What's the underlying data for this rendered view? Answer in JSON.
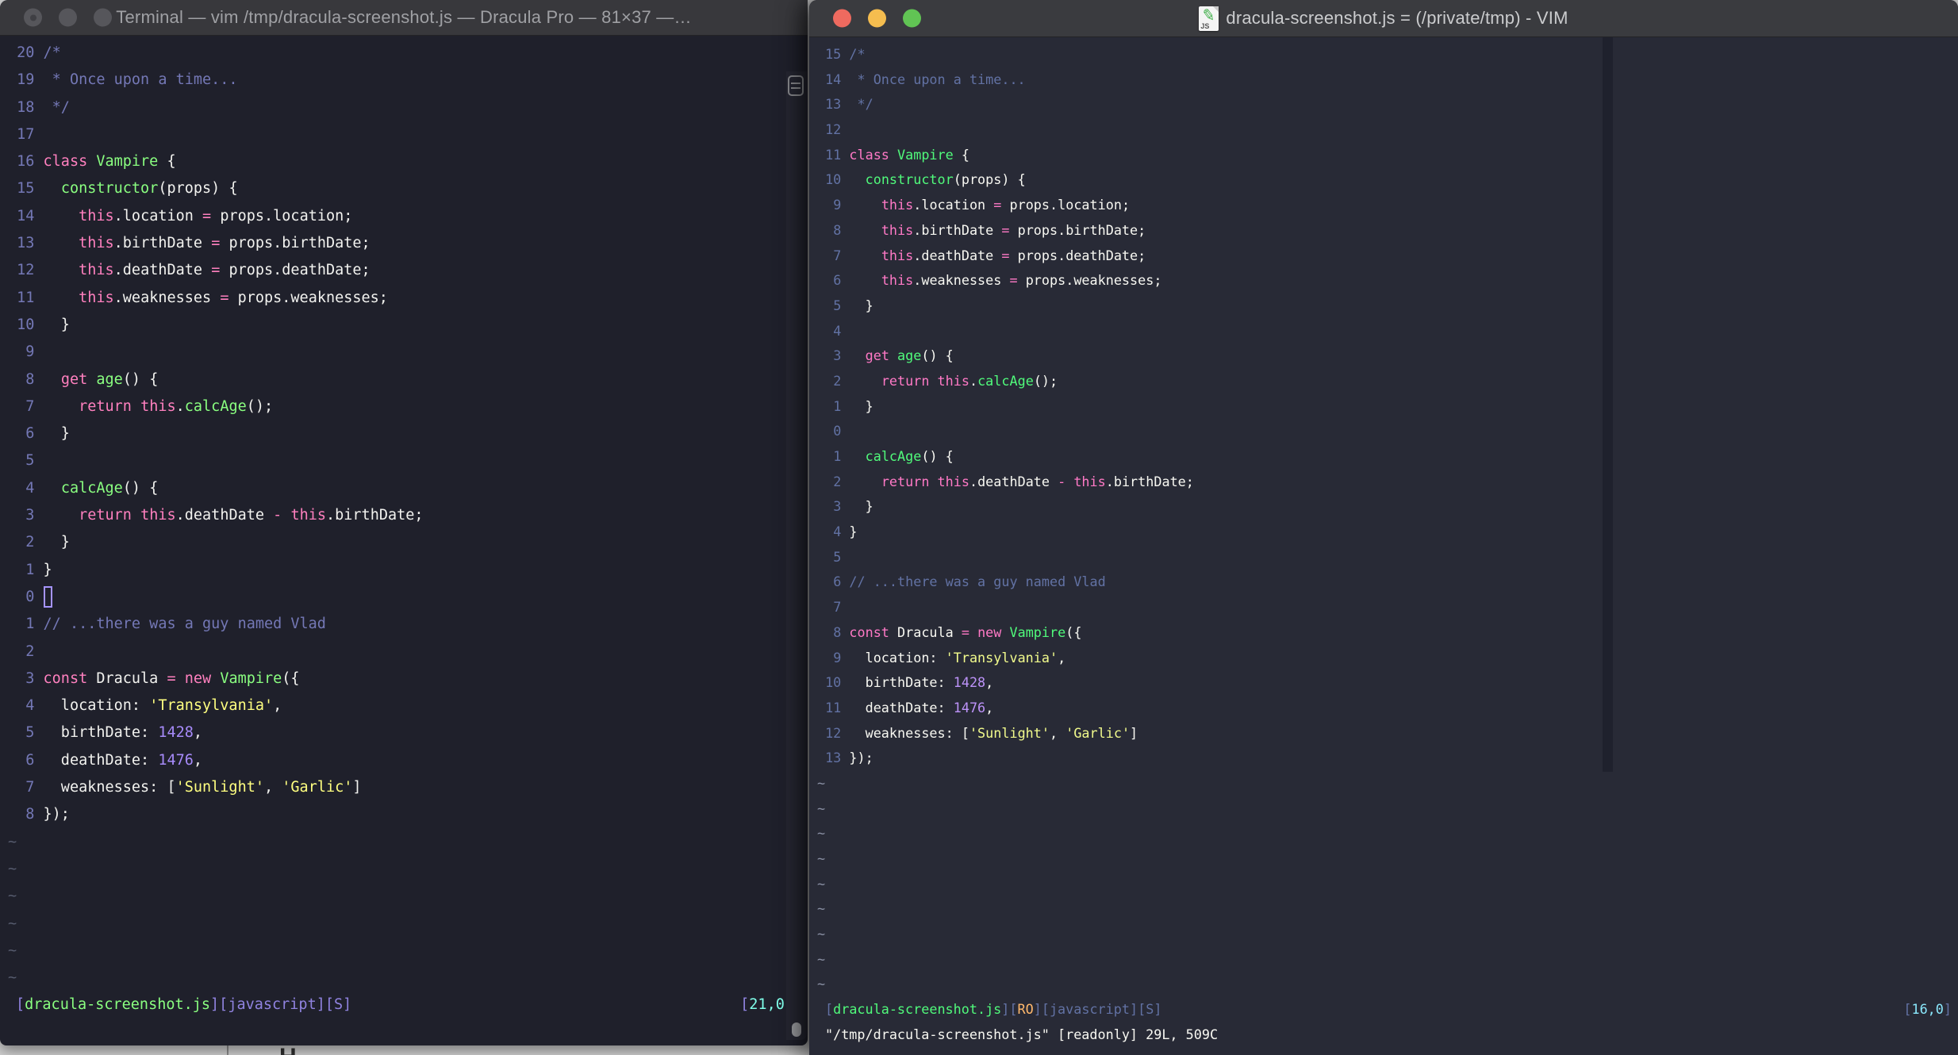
{
  "left_window": {
    "title": "Terminal — vim /tmp/dracula-screenshot.js — Dracula Pro — 81×37 —…",
    "kind": "terminal-vim",
    "line_numbers": [
      "20",
      "19",
      "18",
      "17",
      "16",
      "15",
      "14",
      "13",
      "12",
      "11",
      "10",
      "9",
      "8",
      "7",
      "6",
      "5",
      "4",
      "3",
      "2",
      "1",
      "0",
      "1",
      "2",
      "3",
      "4",
      "5",
      "6",
      "7",
      "8"
    ],
    "tilde_count": 6,
    "cursor_row": 20,
    "cursor_visible": true,
    "status_left": [
      [
        "br",
        "["
      ],
      [
        "file",
        "dracula-screenshot.js"
      ],
      [
        "br",
        "]["
      ],
      [
        "br",
        "javascript"
      ],
      [
        "br",
        "]["
      ],
      [
        "br",
        "S"
      ],
      [
        "br",
        "]"
      ]
    ],
    "status_right": [
      [
        "br",
        "["
      ],
      [
        "cyan",
        "21,0"
      ],
      [
        "br",
        "]"
      ]
    ],
    "cmdline": "",
    "palette": {
      "bg": "#1f202b",
      "fg": "#f2f2ef",
      "comment": "#7478b6",
      "pink": "#ff80bf",
      "green": "#8aff80",
      "yellow": "#ffff80",
      "purple": "#a78bfa",
      "cyan": "#80ffea",
      "status_bracket": "#9083e0",
      "file_green": "#8aff80"
    }
  },
  "right_window": {
    "title": "dracula-screenshot.js = (/private/tmp) - VIM",
    "kind": "macvim",
    "doc_icon": "js-document-icon",
    "doc_icon_label": "JS",
    "line_numbers": [
      "15",
      "14",
      "13",
      "12",
      "11",
      "10",
      "9",
      "8",
      "7",
      "6",
      "5",
      "4",
      "3",
      "2",
      "1",
      "0",
      "1",
      "2",
      "3",
      "4",
      "5",
      "6",
      "7",
      "8",
      "9",
      "10",
      "11",
      "12",
      "13"
    ],
    "tilde_count": 9,
    "cursor_row": 15,
    "cursor_visible": false,
    "status_left": [
      [
        "br",
        "["
      ],
      [
        "file",
        "dracula-screenshot.js"
      ],
      [
        "br",
        "]["
      ],
      [
        "orange",
        "RO"
      ],
      [
        "br",
        "]["
      ],
      [
        "br",
        "javascript"
      ],
      [
        "br",
        "]["
      ],
      [
        "br",
        "S"
      ],
      [
        "br",
        "]"
      ]
    ],
    "status_right": [
      [
        "br",
        "["
      ],
      [
        "cyan",
        "16,0"
      ],
      [
        "br",
        "]"
      ]
    ],
    "cmdline": "\"/tmp/dracula-screenshot.js\" [readonly] 29L, 509C",
    "palette": {
      "bg": "#282a36",
      "fg": "#f8f8f2",
      "comment": "#6272a4",
      "pink": "#ff79c6",
      "green": "#50fa7b",
      "yellow": "#f1fa8c",
      "purple": "#bd93f9",
      "cyan": "#8be9fd",
      "orange": "#ffb86c",
      "status_bracket": "#6272a4",
      "file_green": "#50fa7b"
    }
  },
  "code_lines": [
    [
      [
        "comment",
        "/*"
      ]
    ],
    [
      [
        "comment",
        " * Once upon a time..."
      ]
    ],
    [
      [
        "comment",
        " */"
      ]
    ],
    [],
    [
      [
        "pink",
        "class "
      ],
      [
        "green",
        "Vampire "
      ],
      [
        "fg",
        "{"
      ]
    ],
    [
      [
        "fg",
        "  "
      ],
      [
        "green",
        "constructor"
      ],
      [
        "fg",
        "(props) {"
      ]
    ],
    [
      [
        "fg",
        "    "
      ],
      [
        "pink",
        "this"
      ],
      [
        "fg",
        ".location "
      ],
      [
        "pink",
        "="
      ],
      [
        "fg",
        " props.location;"
      ]
    ],
    [
      [
        "fg",
        "    "
      ],
      [
        "pink",
        "this"
      ],
      [
        "fg",
        ".birthDate "
      ],
      [
        "pink",
        "="
      ],
      [
        "fg",
        " props.birthDate;"
      ]
    ],
    [
      [
        "fg",
        "    "
      ],
      [
        "pink",
        "this"
      ],
      [
        "fg",
        ".deathDate "
      ],
      [
        "pink",
        "="
      ],
      [
        "fg",
        " props.deathDate;"
      ]
    ],
    [
      [
        "fg",
        "    "
      ],
      [
        "pink",
        "this"
      ],
      [
        "fg",
        ".weaknesses "
      ],
      [
        "pink",
        "="
      ],
      [
        "fg",
        " props.weaknesses;"
      ]
    ],
    [
      [
        "fg",
        "  }"
      ]
    ],
    [],
    [
      [
        "fg",
        "  "
      ],
      [
        "pink",
        "get "
      ],
      [
        "green",
        "age"
      ],
      [
        "fg",
        "() {"
      ]
    ],
    [
      [
        "fg",
        "    "
      ],
      [
        "pink",
        "return "
      ],
      [
        "pink",
        "this"
      ],
      [
        "fg",
        "."
      ],
      [
        "green",
        "calcAge"
      ],
      [
        "fg",
        "();"
      ]
    ],
    [
      [
        "fg",
        "  }"
      ]
    ],
    [],
    [
      [
        "fg",
        "  "
      ],
      [
        "green",
        "calcAge"
      ],
      [
        "fg",
        "() {"
      ]
    ],
    [
      [
        "fg",
        "    "
      ],
      [
        "pink",
        "return "
      ],
      [
        "pink",
        "this"
      ],
      [
        "fg",
        ".deathDate "
      ],
      [
        "pink",
        "-"
      ],
      [
        "fg",
        " "
      ],
      [
        "pink",
        "this"
      ],
      [
        "fg",
        ".birthDate;"
      ]
    ],
    [
      [
        "fg",
        "  }"
      ]
    ],
    [
      [
        "fg",
        "}"
      ]
    ],
    [],
    [
      [
        "comment",
        "// ...there was a guy named Vlad"
      ]
    ],
    [],
    [
      [
        "pink",
        "const "
      ],
      [
        "fg",
        "Dracula "
      ],
      [
        "pink",
        "= "
      ],
      [
        "pink",
        "new "
      ],
      [
        "green",
        "Vampire"
      ],
      [
        "fg",
        "({"
      ]
    ],
    [
      [
        "fg",
        "  location: "
      ],
      [
        "yellow",
        "'Transylvania'"
      ],
      [
        "fg",
        ","
      ]
    ],
    [
      [
        "fg",
        "  birthDate: "
      ],
      [
        "purple",
        "1428"
      ],
      [
        "fg",
        ","
      ]
    ],
    [
      [
        "fg",
        "  deathDate: "
      ],
      [
        "purple",
        "1476"
      ],
      [
        "fg",
        ","
      ]
    ],
    [
      [
        "fg",
        "  weaknesses: ["
      ],
      [
        "yellow",
        "'Sunlight'"
      ],
      [
        "fg",
        ", "
      ],
      [
        "yellow",
        "'Garlic'"
      ],
      [
        "fg",
        "]"
      ]
    ],
    [
      [
        "fg",
        "});"
      ]
    ]
  ]
}
